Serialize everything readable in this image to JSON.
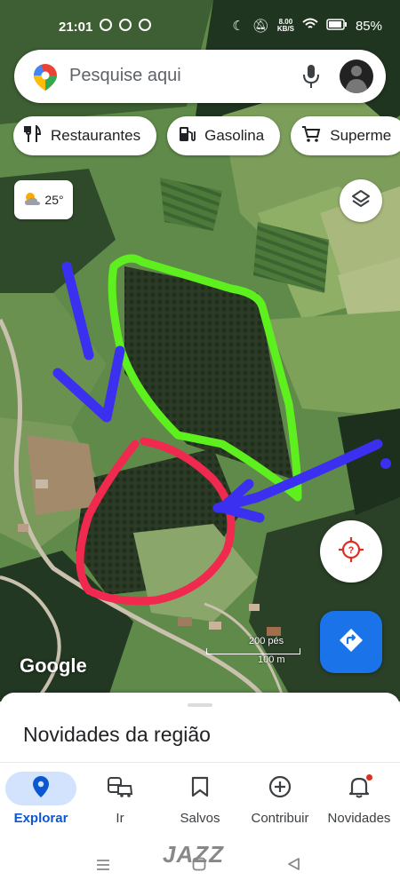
{
  "status_bar": {
    "time": "21:01",
    "net_speed_value": "8.00",
    "net_speed_unit": "KB/S",
    "battery": "85%"
  },
  "search": {
    "placeholder": "Pesquise aqui"
  },
  "chips": [
    {
      "label": "Restaurantes",
      "icon": "restaurant-icon"
    },
    {
      "label": "Gasolina",
      "icon": "gas-station-icon"
    },
    {
      "label": "Superme",
      "icon": "cart-icon"
    }
  ],
  "weather": {
    "temp": "25°",
    "icon": "partly-cloudy-icon"
  },
  "map": {
    "attribution": "Google",
    "scale_top": "200 pés",
    "scale_bottom": "100 m"
  },
  "sheet": {
    "title": "Novidades da região"
  },
  "bottom_nav": [
    {
      "label": "Explorar",
      "icon": "location-pin-icon",
      "active": true
    },
    {
      "label": "Ir",
      "icon": "commute-icon",
      "active": false
    },
    {
      "label": "Salvos",
      "icon": "bookmark-icon",
      "active": false
    },
    {
      "label": "Contribuir",
      "icon": "add-circle-icon",
      "active": false
    },
    {
      "label": "Novidades",
      "icon": "bell-icon",
      "active": false
    }
  ],
  "watermark": "JAZZ",
  "colors": {
    "accent": "#1a73e8",
    "active_pill": "#d3e3fd",
    "annotation_green": "#5ef01e",
    "annotation_red": "#f0294f",
    "annotation_blue": "#3b2ff0"
  }
}
